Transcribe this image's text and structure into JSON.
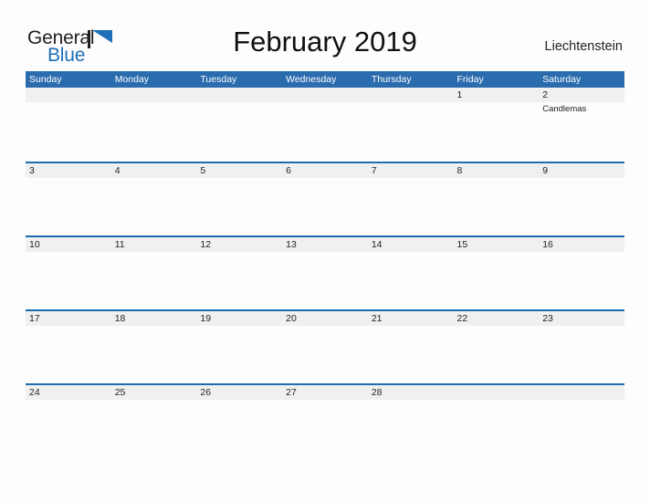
{
  "brand": {
    "name_part1": "General",
    "name_part2": "Blue",
    "flag_icon": "flag-triangle-icon",
    "accent_color": "#1f6fb8"
  },
  "header": {
    "title": "February 2019",
    "country": "Liechtenstein"
  },
  "theme": {
    "header_bg": "#2b6cae",
    "rule_color": "#1f6cae",
    "band_bg": "#f0f0f0",
    "page_bg": "#fdfdfd",
    "text_color": "#222222"
  },
  "calendar": {
    "month": "February",
    "year": "2019",
    "weekdays": [
      "Sunday",
      "Monday",
      "Tuesday",
      "Wednesday",
      "Thursday",
      "Friday",
      "Saturday"
    ],
    "weeks": [
      [
        {
          "day": "",
          "event": ""
        },
        {
          "day": "",
          "event": ""
        },
        {
          "day": "",
          "event": ""
        },
        {
          "day": "",
          "event": ""
        },
        {
          "day": "",
          "event": ""
        },
        {
          "day": "1",
          "event": ""
        },
        {
          "day": "2",
          "event": "Candlemas"
        }
      ],
      [
        {
          "day": "3",
          "event": ""
        },
        {
          "day": "4",
          "event": ""
        },
        {
          "day": "5",
          "event": ""
        },
        {
          "day": "6",
          "event": ""
        },
        {
          "day": "7",
          "event": ""
        },
        {
          "day": "8",
          "event": ""
        },
        {
          "day": "9",
          "event": ""
        }
      ],
      [
        {
          "day": "10",
          "event": ""
        },
        {
          "day": "11",
          "event": ""
        },
        {
          "day": "12",
          "event": ""
        },
        {
          "day": "13",
          "event": ""
        },
        {
          "day": "14",
          "event": ""
        },
        {
          "day": "15",
          "event": ""
        },
        {
          "day": "16",
          "event": ""
        }
      ],
      [
        {
          "day": "17",
          "event": ""
        },
        {
          "day": "18",
          "event": ""
        },
        {
          "day": "19",
          "event": ""
        },
        {
          "day": "20",
          "event": ""
        },
        {
          "day": "21",
          "event": ""
        },
        {
          "day": "22",
          "event": ""
        },
        {
          "day": "23",
          "event": ""
        }
      ],
      [
        {
          "day": "24",
          "event": ""
        },
        {
          "day": "25",
          "event": ""
        },
        {
          "day": "26",
          "event": ""
        },
        {
          "day": "27",
          "event": ""
        },
        {
          "day": "28",
          "event": ""
        },
        {
          "day": "",
          "event": ""
        },
        {
          "day": "",
          "event": ""
        }
      ]
    ]
  }
}
